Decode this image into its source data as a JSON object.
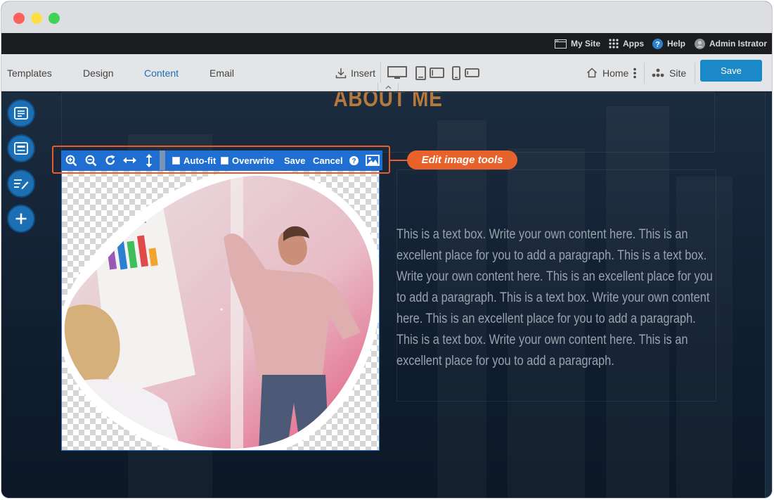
{
  "window": {
    "traffic_lights": [
      "close",
      "minimize",
      "maximize"
    ]
  },
  "admin_bar": {
    "my_site": "My Site",
    "apps": "Apps",
    "help": "Help",
    "user": "Admin Istrator"
  },
  "toolbar": {
    "tabs": [
      {
        "label": "Templates",
        "active": false
      },
      {
        "label": "Design",
        "active": false
      },
      {
        "label": "Content",
        "active": true
      },
      {
        "label": "Email",
        "active": false
      }
    ],
    "insert": "Insert",
    "home": "Home",
    "site": "Site",
    "save": "Save",
    "device_icons": [
      "desktop-icon",
      "tablet-icon",
      "tablet-landscape-icon",
      "phone-icon",
      "phone-landscape-icon"
    ]
  },
  "page": {
    "heading": "ABOUT ME",
    "body": "This is a text box. Write your own content here. This is an excellent place for you to add a paragraph. This is a text box. Write your own content here. This is an excellent place for you to add a paragraph. This is a text box. Write your own content here. This is an excellent place for you to add a paragraph. This is a text box. Write your own content here. This is an excellent place for you to add a paragraph.",
    "side_buttons": [
      "layout-icon",
      "section-icon",
      "edit-text-icon",
      "add-icon"
    ]
  },
  "image_editor": {
    "tools": [
      "zoom-in-icon",
      "zoom-out-icon",
      "rotate-icon",
      "stretch-horizontal-icon",
      "stretch-vertical-icon"
    ],
    "auto_fit": "Auto-fit",
    "overwrite": "Overwrite",
    "save": "Save",
    "cancel": "Cancel",
    "help": "?",
    "callout": "Edit image tools"
  },
  "colors": {
    "accent": "#1f6fd2",
    "save_button": "#1b88c8",
    "callout": "#e8622c",
    "heading": "#b47a3d",
    "active_tab": "#1f6fb5"
  }
}
